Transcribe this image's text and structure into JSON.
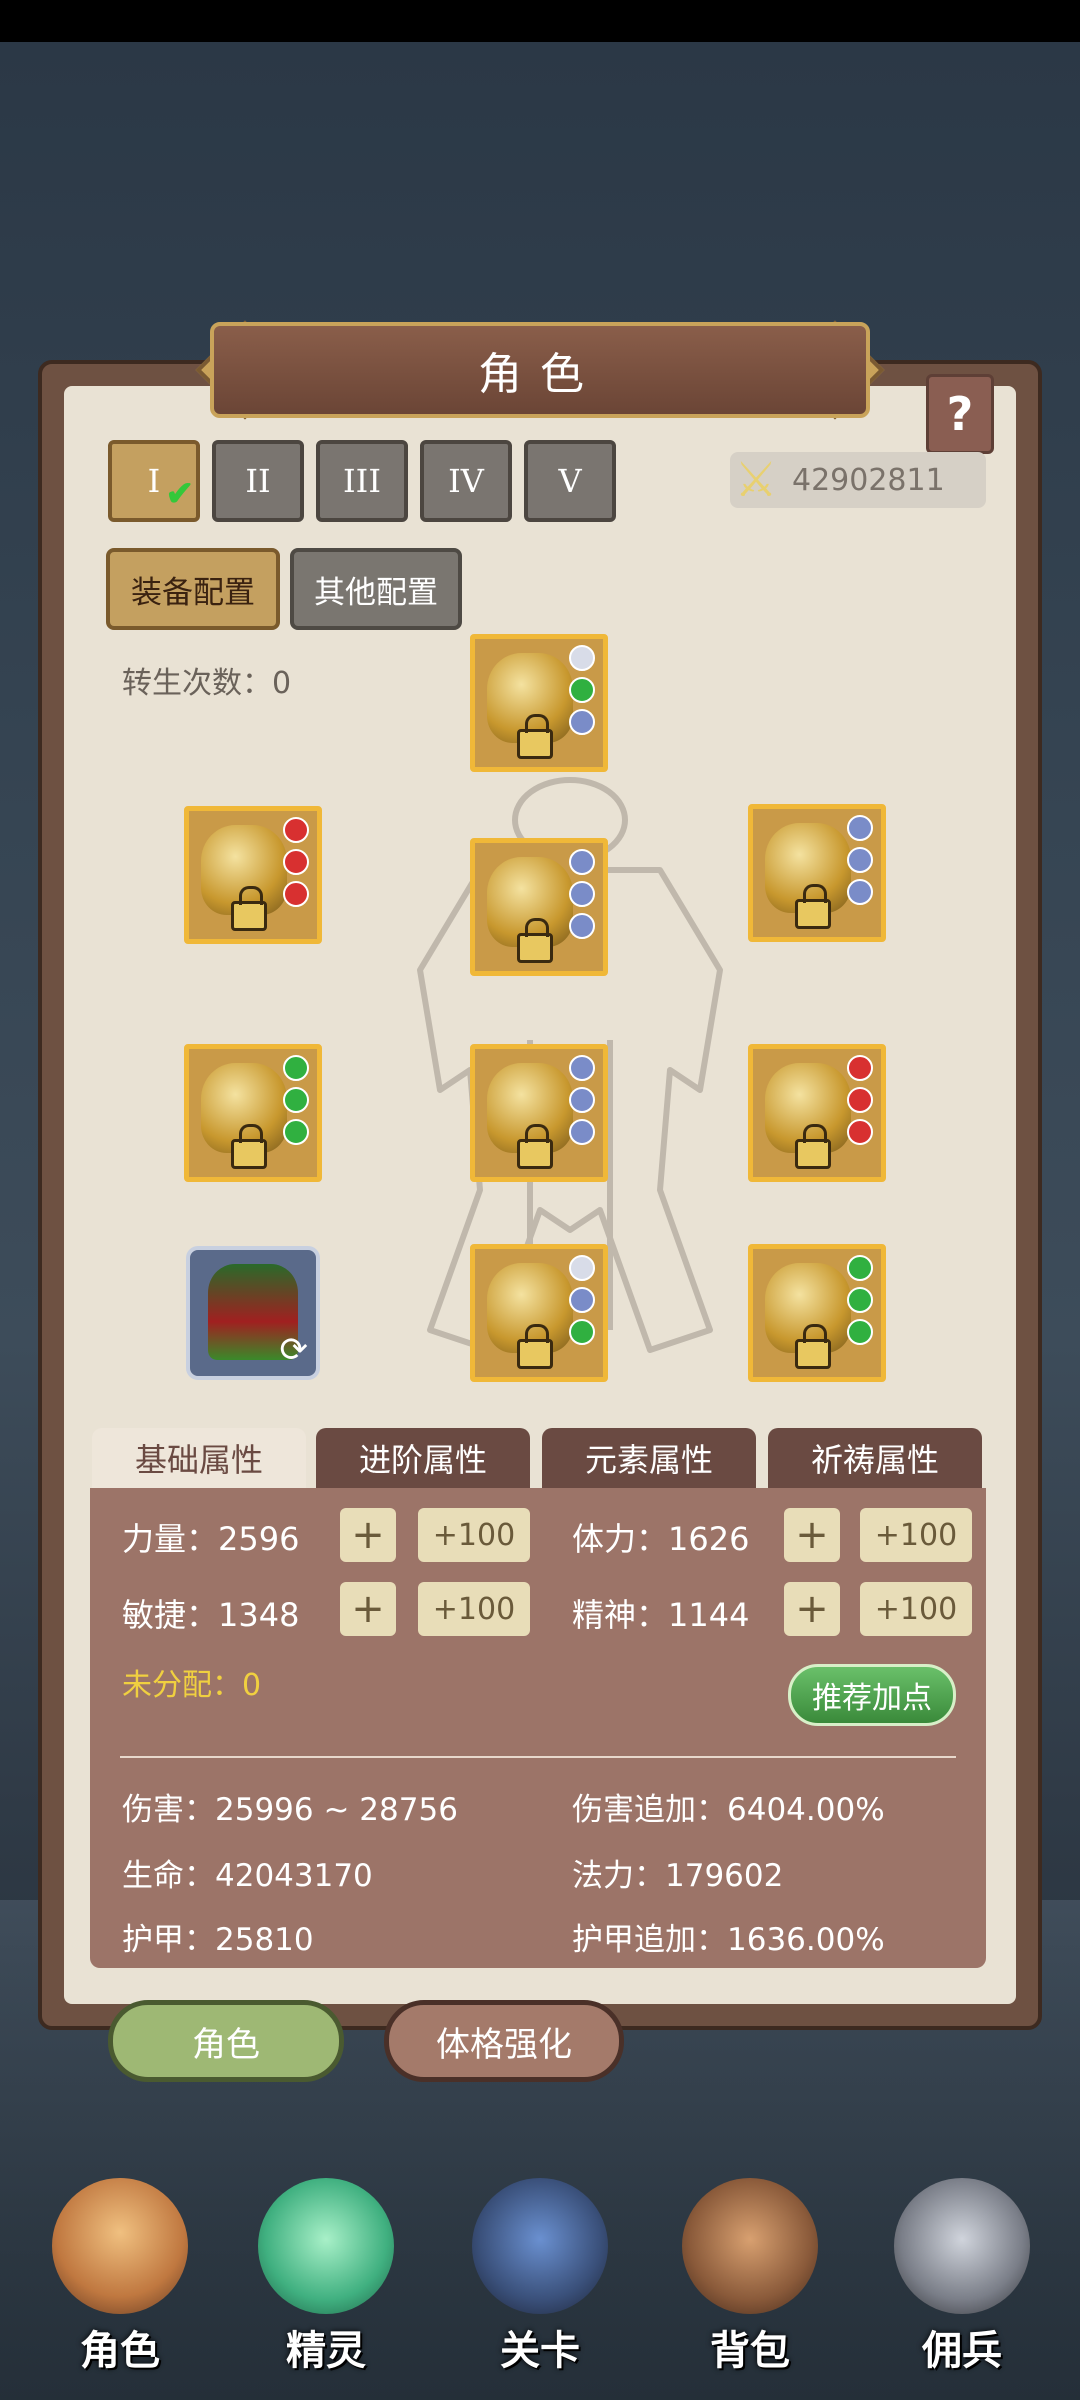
{
  "title": "角色",
  "help_label": "?",
  "presets": [
    {
      "label": "I",
      "active": true
    },
    {
      "label": "II",
      "active": false
    },
    {
      "label": "III",
      "active": false
    },
    {
      "label": "IV",
      "active": false
    },
    {
      "label": "V",
      "active": false
    }
  ],
  "power": {
    "icon": "crossed-swords-icon",
    "value": "42902811"
  },
  "config_tabs": {
    "equip": "装备配置",
    "other": "其他配置"
  },
  "rebirth": "转生次数：0",
  "stat_tabs": [
    "基础属性",
    "进阶属性",
    "元素属性",
    "祈祷属性"
  ],
  "stats": {
    "strength": "力量：2596",
    "stamina": "体力：1626",
    "agility": "敏捷：1348",
    "spirit": "精神：1144",
    "plus": "+",
    "plus100": "+100",
    "unassigned": "未分配：0",
    "recommend": "推荐加点"
  },
  "derived": {
    "damage": "伤害：25996 ~ 28756",
    "damage_bonus": "伤害追加：6404.00%",
    "hp": "生命：42043170",
    "mp": "法力：179602",
    "armor": "护甲：25810",
    "armor_bonus": "护甲追加：1636.00%"
  },
  "bottom_buttons": {
    "role": "角色",
    "physique": "体格强化"
  },
  "nav": [
    "角色",
    "精灵",
    "关卡",
    "背包",
    "佣兵"
  ],
  "colors": {
    "accent_gold": "#c4a060",
    "slot_border": "#f0b838",
    "green_button": "#4aa04a"
  }
}
